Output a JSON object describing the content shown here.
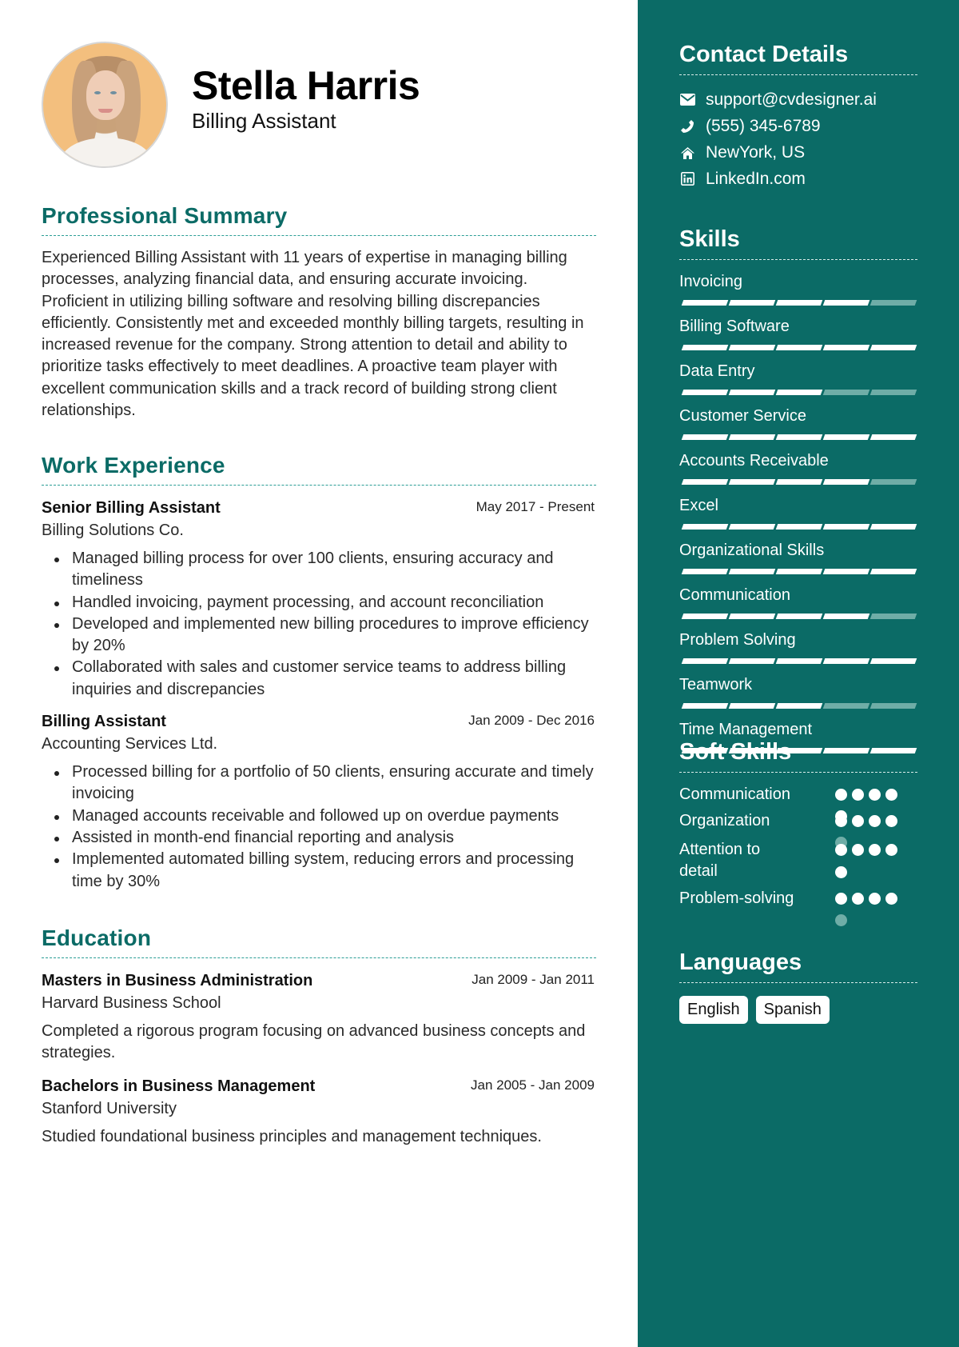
{
  "header": {
    "name": "Stella Harris",
    "title": "Billing Assistant"
  },
  "summary": {
    "heading": "Professional Summary",
    "text": "Experienced Billing Assistant with 11 years of expertise in managing billing processes, analyzing financial data, and ensuring accurate invoicing. Proficient in utilizing billing software and resolving billing discrepancies efficiently. Consistently met and exceeded monthly billing targets, resulting in increased revenue for the company. Strong attention to detail and ability to prioritize tasks effectively to meet deadlines. A proactive team player with excellent communication skills and a track record of building strong client relationships."
  },
  "experience": {
    "heading": "Work Experience",
    "jobs": [
      {
        "title": "Senior Billing Assistant",
        "date": "May 2017 - Present",
        "company": "Billing Solutions Co.",
        "bullets": [
          "Managed billing process for over 100 clients, ensuring accuracy and timeliness",
          "Handled invoicing, payment processing, and account reconciliation",
          "Developed and implemented new billing procedures to improve efficiency by 20%",
          "Collaborated with sales and customer service teams to address billing inquiries and discrepancies"
        ]
      },
      {
        "title": "Billing Assistant",
        "date": "Jan 2009 - Dec 2016",
        "company": "Accounting Services Ltd.",
        "bullets": [
          "Processed billing for a portfolio of 50 clients, ensuring accurate and timely invoicing",
          "Managed accounts receivable and followed up on overdue payments",
          "Assisted in month-end financial reporting and analysis",
          "Implemented automated billing system, reducing errors and processing time by 30%"
        ]
      }
    ]
  },
  "education": {
    "heading": "Education",
    "items": [
      {
        "degree": "Masters in Business Administration",
        "date": "Jan 2009 - Jan 2011",
        "school": "Harvard Business School",
        "description": "Completed a rigorous program focusing on advanced business concepts and strategies."
      },
      {
        "degree": "Bachelors in Business Management",
        "date": "Jan 2005 - Jan 2009",
        "school": "Stanford University",
        "description": "Studied foundational business principles and management techniques."
      }
    ]
  },
  "contact": {
    "heading": "Contact Details",
    "items": [
      {
        "icon": "envelope-icon",
        "value": "support@cvdesigner.ai"
      },
      {
        "icon": "phone-icon",
        "value": "(555) 345-6789"
      },
      {
        "icon": "home-icon",
        "value": "NewYork, US"
      },
      {
        "icon": "linkedin-icon",
        "value": "LinkedIn.com"
      }
    ]
  },
  "skills": {
    "heading": "Skills",
    "max": 5,
    "items": [
      {
        "name": "Invoicing",
        "level": 4
      },
      {
        "name": "Billing Software",
        "level": 5
      },
      {
        "name": "Data Entry",
        "level": 3
      },
      {
        "name": "Customer Service",
        "level": 5
      },
      {
        "name": "Accounts Receivable",
        "level": 4
      },
      {
        "name": "Excel",
        "level": 5
      },
      {
        "name": "Organizational Skills",
        "level": 5
      },
      {
        "name": "Communication",
        "level": 4
      },
      {
        "name": "Problem Solving",
        "level": 5
      },
      {
        "name": "Teamwork",
        "level": 3
      },
      {
        "name": "Time Management",
        "level": 5
      }
    ]
  },
  "soft_skills": {
    "heading": "Soft Skills",
    "max": 5,
    "items": [
      {
        "name": "Communication",
        "level": 5
      },
      {
        "name": "Organization",
        "level": 4
      },
      {
        "name": "Attention to detail",
        "level": 5
      },
      {
        "name": "Problem-solving",
        "level": 4
      }
    ]
  },
  "languages": {
    "heading": "Languages",
    "items": [
      "English",
      "Spanish"
    ]
  },
  "colors": {
    "sidebar": "#0b6b66",
    "heading": "#0b6b66",
    "divider": "#2a9d95",
    "inactive": "#6fada7"
  }
}
